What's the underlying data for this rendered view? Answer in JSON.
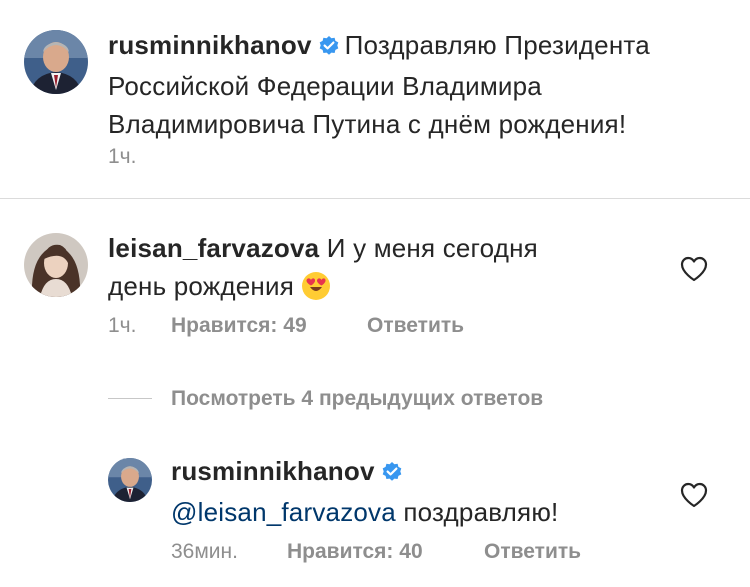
{
  "post": {
    "username": "rusminnikhanov",
    "caption_line1": "Поздравляю Президента",
    "caption_line2": "Российской Федерации Владимира",
    "caption_line3": "Владимировича Путина с днём рождения!",
    "time": "1ч."
  },
  "comment": {
    "username": "leisan_farvazova",
    "text_line1": "И у меня сегодня",
    "text_line2": "день рождения",
    "emoji": "heart-eyes-emoji",
    "time": "1ч.",
    "likes": "Нравится: 49",
    "reply": "Ответить"
  },
  "view_replies": "Посмотреть 4 предыдущих ответов",
  "reply": {
    "username": "rusminnikhanov",
    "mention": "@leisan_farvazova",
    "text": "поздравляю!",
    "time": "36мин.",
    "likes": "Нравится: 40",
    "reply": "Ответить"
  },
  "colors": {
    "verified": "#3897f0",
    "secondary": "#8e8e8e",
    "mention": "#00376b"
  },
  "icons": [
    "verified-badge-icon",
    "heart-outline-icon",
    "heart-eyes-emoji"
  ]
}
